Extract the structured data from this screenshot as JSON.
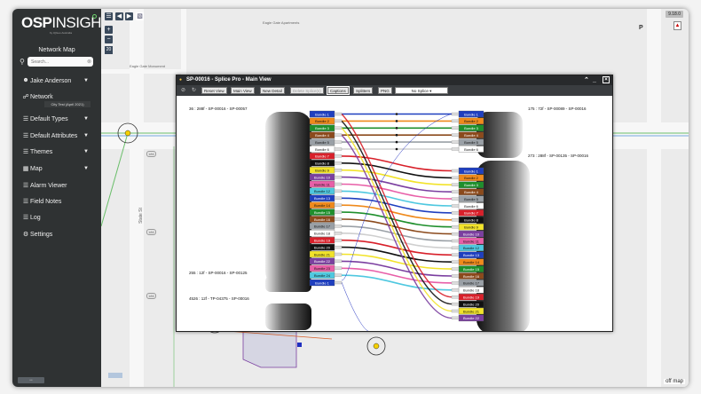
{
  "app": {
    "logo_bold": "OSP",
    "logo_light": "INSIGHT",
    "logo_sub": "by iQGeo Australia",
    "map_title": "Network Map"
  },
  "search": {
    "placeholder": "Search..."
  },
  "sidebar": {
    "user": "Jake Anderson",
    "network_label": "Network",
    "network_badge": "City Test (April 2021)",
    "items": [
      {
        "label": "Default Types",
        "icon": "list-icon",
        "chevron": true
      },
      {
        "label": "Default Attributes",
        "icon": "list-icon",
        "chevron": true
      },
      {
        "label": "Themes",
        "icon": "list-icon",
        "chevron": true
      },
      {
        "label": "Map",
        "icon": "map-icon",
        "chevron": true
      },
      {
        "label": "Alarm Viewer",
        "icon": "list-icon",
        "chevron": false
      },
      {
        "label": "Field Notes",
        "icon": "list-icon",
        "chevron": false
      },
      {
        "label": "Log",
        "icon": "list-icon",
        "chevron": false
      },
      {
        "label": "Settings",
        "icon": "gear-icon",
        "chevron": false
      }
    ]
  },
  "map": {
    "version": "9.18.0",
    "zoom_level": "20",
    "off_map": "off map",
    "labels": {
      "apartments": "Eagle Gate Apartments",
      "monument": "Eagle Gate Monument",
      "street": "State St",
      "route1": "186",
      "route2": "186",
      "route3": "186",
      "p_marker": "P"
    }
  },
  "splice": {
    "title": "SP-00016 - Splice Pro - Main View",
    "toolbar": {
      "reset_view": "Reset View",
      "main_view": "Main View",
      "new_detail": "New Detail",
      "delete_splices": "Delete Splice(s)",
      "captions": "Captions",
      "splitters": "Splitters",
      "png": "PNG",
      "select_value": "No Splice"
    },
    "cables": {
      "left_top": "36 : 288f - SP-00016 - SP-00057",
      "left_mid": "255 : 12f - SP-00016 - SP-00125",
      "left_bot": "4526 : 12f - TP-04375 - SP-00016",
      "right_top": "175 : 72f - SP-00089 - SP-00016",
      "right_bot": "273 : 288f - SP-00135 - SP-00016"
    },
    "left_bundles": [
      "Bundle 1",
      "Bundle 2",
      "Bundle 3",
      "Bundle 4",
      "Bundle 5",
      "Bundle 6",
      "Bundle 7",
      "Bundle 8",
      "Bundle 9",
      "Bundle 10",
      "Bundle 11",
      "Bundle 12",
      "Bundle 13",
      "Bundle 14",
      "Bundle 15",
      "Bundle 16",
      "Bundle 17",
      "Bundle 18",
      "Bundle 19",
      "Bundle 20",
      "Bundle 21",
      "Bundle 22",
      "Bundle 23",
      "Bundle 24"
    ],
    "left_mid_bundles": [
      "Bundle 1"
    ],
    "right_top_bundles": [
      "Bundle 1",
      "Bundle 2",
      "Bundle 3",
      "Bundle 4",
      "Bundle 5",
      "Bundle 6"
    ],
    "right_bot_bundles": [
      "Bundle 1",
      "Bundle 2",
      "Bundle 3",
      "Bundle 4",
      "Bundle 5",
      "Bundle 6",
      "Bundle 7",
      "Bundle 8",
      "Bundle 9",
      "Bundle 10",
      "Bundle 11",
      "Bundle 12",
      "Bundle 13",
      "Bundle 14",
      "Bundle 15",
      "Bundle 16",
      "Bundle 17",
      "Bundle 18",
      "Bundle 19",
      "Bundle 20",
      "Bundle 21",
      "Bundle 22"
    ],
    "fiber_colors": [
      "#1f3fbf",
      "#ef8a1c",
      "#1f8f2c",
      "#8b4a1c",
      "#9aa0a6",
      "#ffffff",
      "#d8202a",
      "#111111",
      "#f2e32a",
      "#7b3fa0",
      "#e85fa8",
      "#4fc8e0"
    ]
  },
  "colors": {
    "sidebar_bg": "#2f3233",
    "titlebar_bg": "#282a2c",
    "accent_green": "#6dd36d",
    "map_bg": "#ebebeb"
  }
}
